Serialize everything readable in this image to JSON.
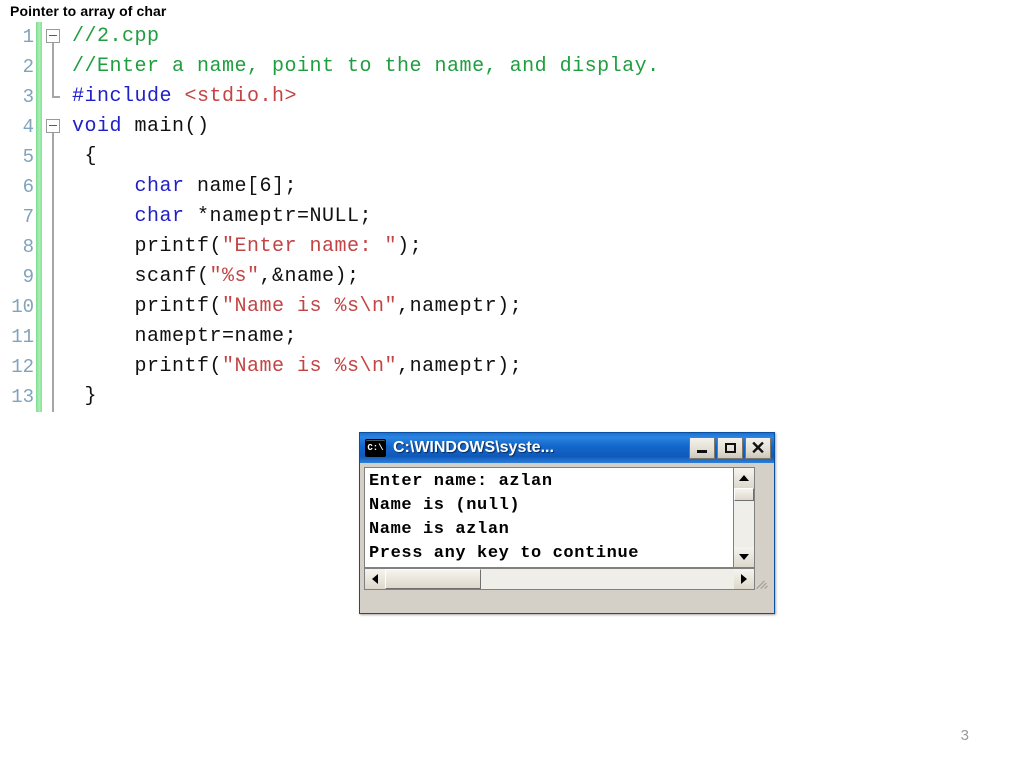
{
  "slide": {
    "title": "Pointer to array of char",
    "page_number": "3"
  },
  "editor": {
    "gutter_accent_color": "#92e6a0",
    "line_number_color": "#80a4bc",
    "colors": {
      "comment": "#1f9e3f",
      "keyword": "#2020c8",
      "preprocessor": "#2020c8",
      "string": "#c24444",
      "plain": "#111111"
    },
    "lines": [
      {
        "n": "1",
        "fold": "box-start",
        "tokens": [
          {
            "t": "//2.cpp",
            "c": "comment"
          }
        ]
      },
      {
        "n": "2",
        "fold": "line",
        "tokens": [
          {
            "t": "//Enter a name, point to the name, and display.",
            "c": "comment"
          }
        ]
      },
      {
        "n": "3",
        "fold": "corner",
        "tokens": [
          {
            "t": "#include ",
            "c": "pre"
          },
          {
            "t": "<stdio.h>",
            "c": "string"
          }
        ]
      },
      {
        "n": "4",
        "fold": "box-start",
        "tokens": [
          {
            "t": "void ",
            "c": "keyword"
          },
          {
            "t": "main()",
            "c": "plain"
          }
        ]
      },
      {
        "n": "5",
        "fold": "line",
        "tokens": [
          {
            "t": " {",
            "c": "plain"
          }
        ]
      },
      {
        "n": "6",
        "fold": "line",
        "tokens": [
          {
            "t": "     ",
            "c": "plain"
          },
          {
            "t": "char",
            "c": "keyword"
          },
          {
            "t": " name[6];",
            "c": "plain"
          }
        ]
      },
      {
        "n": "7",
        "fold": "line",
        "tokens": [
          {
            "t": "     ",
            "c": "plain"
          },
          {
            "t": "char",
            "c": "keyword"
          },
          {
            "t": " *nameptr=NULL;",
            "c": "plain"
          }
        ]
      },
      {
        "n": "8",
        "fold": "line",
        "tokens": [
          {
            "t": "     printf(",
            "c": "plain"
          },
          {
            "t": "\"Enter name: \"",
            "c": "string"
          },
          {
            "t": ");",
            "c": "plain"
          }
        ]
      },
      {
        "n": "9",
        "fold": "line",
        "tokens": [
          {
            "t": "     scanf(",
            "c": "plain"
          },
          {
            "t": "\"%s\"",
            "c": "string"
          },
          {
            "t": ",&name);",
            "c": "plain"
          }
        ]
      },
      {
        "n": "10",
        "fold": "line",
        "tokens": [
          {
            "t": "     printf(",
            "c": "plain"
          },
          {
            "t": "\"Name is %s\\n\"",
            "c": "string"
          },
          {
            "t": ",nameptr);",
            "c": "plain"
          }
        ]
      },
      {
        "n": "11",
        "fold": "line",
        "tokens": [
          {
            "t": "     nameptr=name;",
            "c": "plain"
          }
        ]
      },
      {
        "n": "12",
        "fold": "line",
        "tokens": [
          {
            "t": "     printf(",
            "c": "plain"
          },
          {
            "t": "\"Name is %s\\n\"",
            "c": "string"
          },
          {
            "t": ",nameptr);",
            "c": "plain"
          }
        ]
      },
      {
        "n": "13",
        "fold": "line",
        "tokens": [
          {
            "t": " }",
            "c": "plain"
          }
        ]
      }
    ]
  },
  "console_window": {
    "title": "C:\\WINDOWS\\syste...",
    "icon": "cmd-prompt-icon",
    "icon_label": "C:\\",
    "titlebar_color": "#1568cc",
    "buttons": {
      "minimize": "minimize-button",
      "maximize": "maximize-button",
      "close": "close-button"
    },
    "output_lines": [
      "Enter name: azlan",
      "Name is (null)",
      "Name is azlan",
      "Press any key to continue"
    ],
    "scrollbars": {
      "vertical_up": "scroll-up-arrow",
      "vertical_down": "scroll-down-arrow",
      "horizontal_left": "scroll-left-arrow",
      "horizontal_right": "scroll-right-arrow"
    }
  }
}
